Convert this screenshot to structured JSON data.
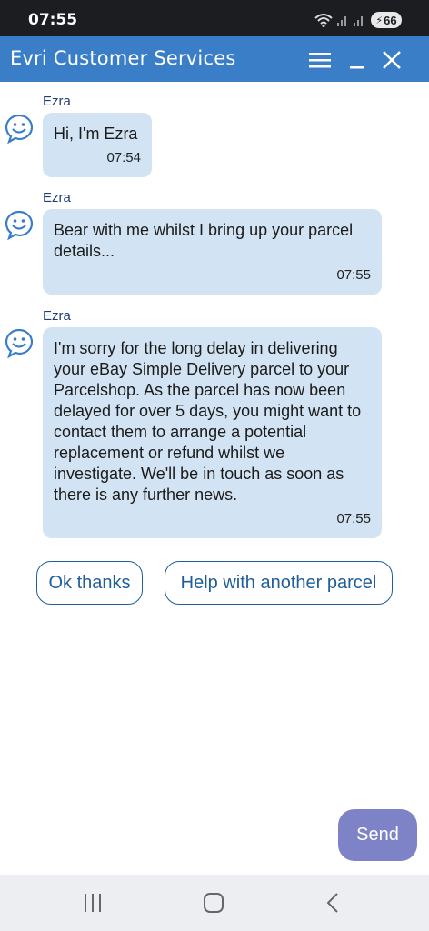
{
  "status_bar": {
    "time": "07:55",
    "battery": "66",
    "wifi_icon": "wifi-icon",
    "signal_icon": "signal-icon"
  },
  "header": {
    "title": "Evri Customer Services",
    "menu_icon": "menu-icon",
    "minimize_icon": "minimize-icon",
    "close_icon": "close-icon"
  },
  "messages": [
    {
      "sender": "Ezra",
      "text": "Hi, I'm Ezra",
      "time": "07:54"
    },
    {
      "sender": "Ezra",
      "text": "Bear with me whilst I bring up your parcel details...",
      "time": "07:55"
    },
    {
      "sender": "Ezra",
      "text": "I'm sorry for the long delay in delivering your eBay Simple Delivery parcel to your Parcelshop. As the parcel has now been delayed for over 5 days, you might want to contact them to arrange a potential replacement or refund whilst we investigate. We'll be in touch as soon as there is any further news.",
      "time": "07:55"
    }
  ],
  "quick_replies": [
    "Ok thanks",
    "Help with another parcel"
  ],
  "send_label": "Send",
  "nav": {
    "recents_icon": "recents-icon",
    "home_icon": "home-icon",
    "back_icon": "back-icon"
  },
  "colors": {
    "header": "#3a7ec8",
    "bubble": "#d2e4f3",
    "send": "#7d83c6",
    "accent": "#1f5e99"
  }
}
